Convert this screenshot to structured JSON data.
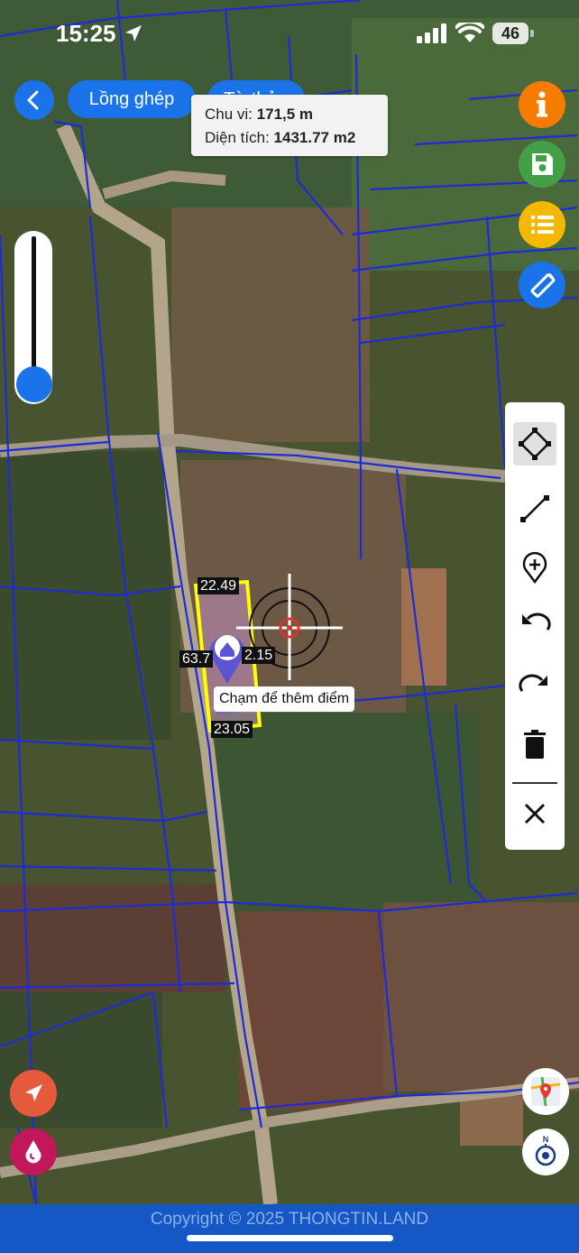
{
  "status_bar": {
    "time": "15:25",
    "battery": "46"
  },
  "header": {
    "back_icon": "chevron-left-icon",
    "tab_merge_label": "Lồng ghép",
    "tab_second_label": "Tờ thửa"
  },
  "measure": {
    "perimeter_label": "Chu vi:",
    "perimeter_value": "171,5 m",
    "area_label": "Diện tích:",
    "area_value": "1431.77 m2"
  },
  "right_buttons": [
    {
      "icon": "info-icon",
      "color": "#f57c00"
    },
    {
      "icon": "save-icon",
      "color": "#43a047"
    },
    {
      "icon": "list-icon",
      "color": "#f5b800"
    },
    {
      "icon": "ruler-edit-icon",
      "color": "#1a73e8"
    }
  ],
  "draw_tools": [
    {
      "icon": "polygon-select-icon",
      "active": true
    },
    {
      "icon": "line-segment-icon",
      "active": false
    },
    {
      "icon": "add-point-icon",
      "active": false
    },
    {
      "icon": "undo-icon",
      "active": false
    },
    {
      "icon": "redo-icon",
      "active": false
    },
    {
      "icon": "trash-icon",
      "active": false
    },
    {
      "icon": "close-icon",
      "active": false
    }
  ],
  "plot_labels": {
    "top": "22.49",
    "left": "63.7",
    "right": "2.15",
    "bottom": "23.05"
  },
  "hint_text": "Chạm để thêm điểm",
  "bottom_left": [
    {
      "icon": "navigate-arrow-icon",
      "color": "#e65a3c"
    },
    {
      "icon": "water-drop-icon",
      "color": "#c2185b"
    }
  ],
  "bottom_right": [
    {
      "icon": "map-layers-icon"
    },
    {
      "icon": "compass-icon"
    }
  ],
  "footer": {
    "copyright": "Copyright © 2025 THONGTIN.LAND"
  },
  "colors": {
    "accent": "#1a73e8",
    "parcel_outline": "#ffff00",
    "boundary_lines": "#1e2bd6"
  }
}
